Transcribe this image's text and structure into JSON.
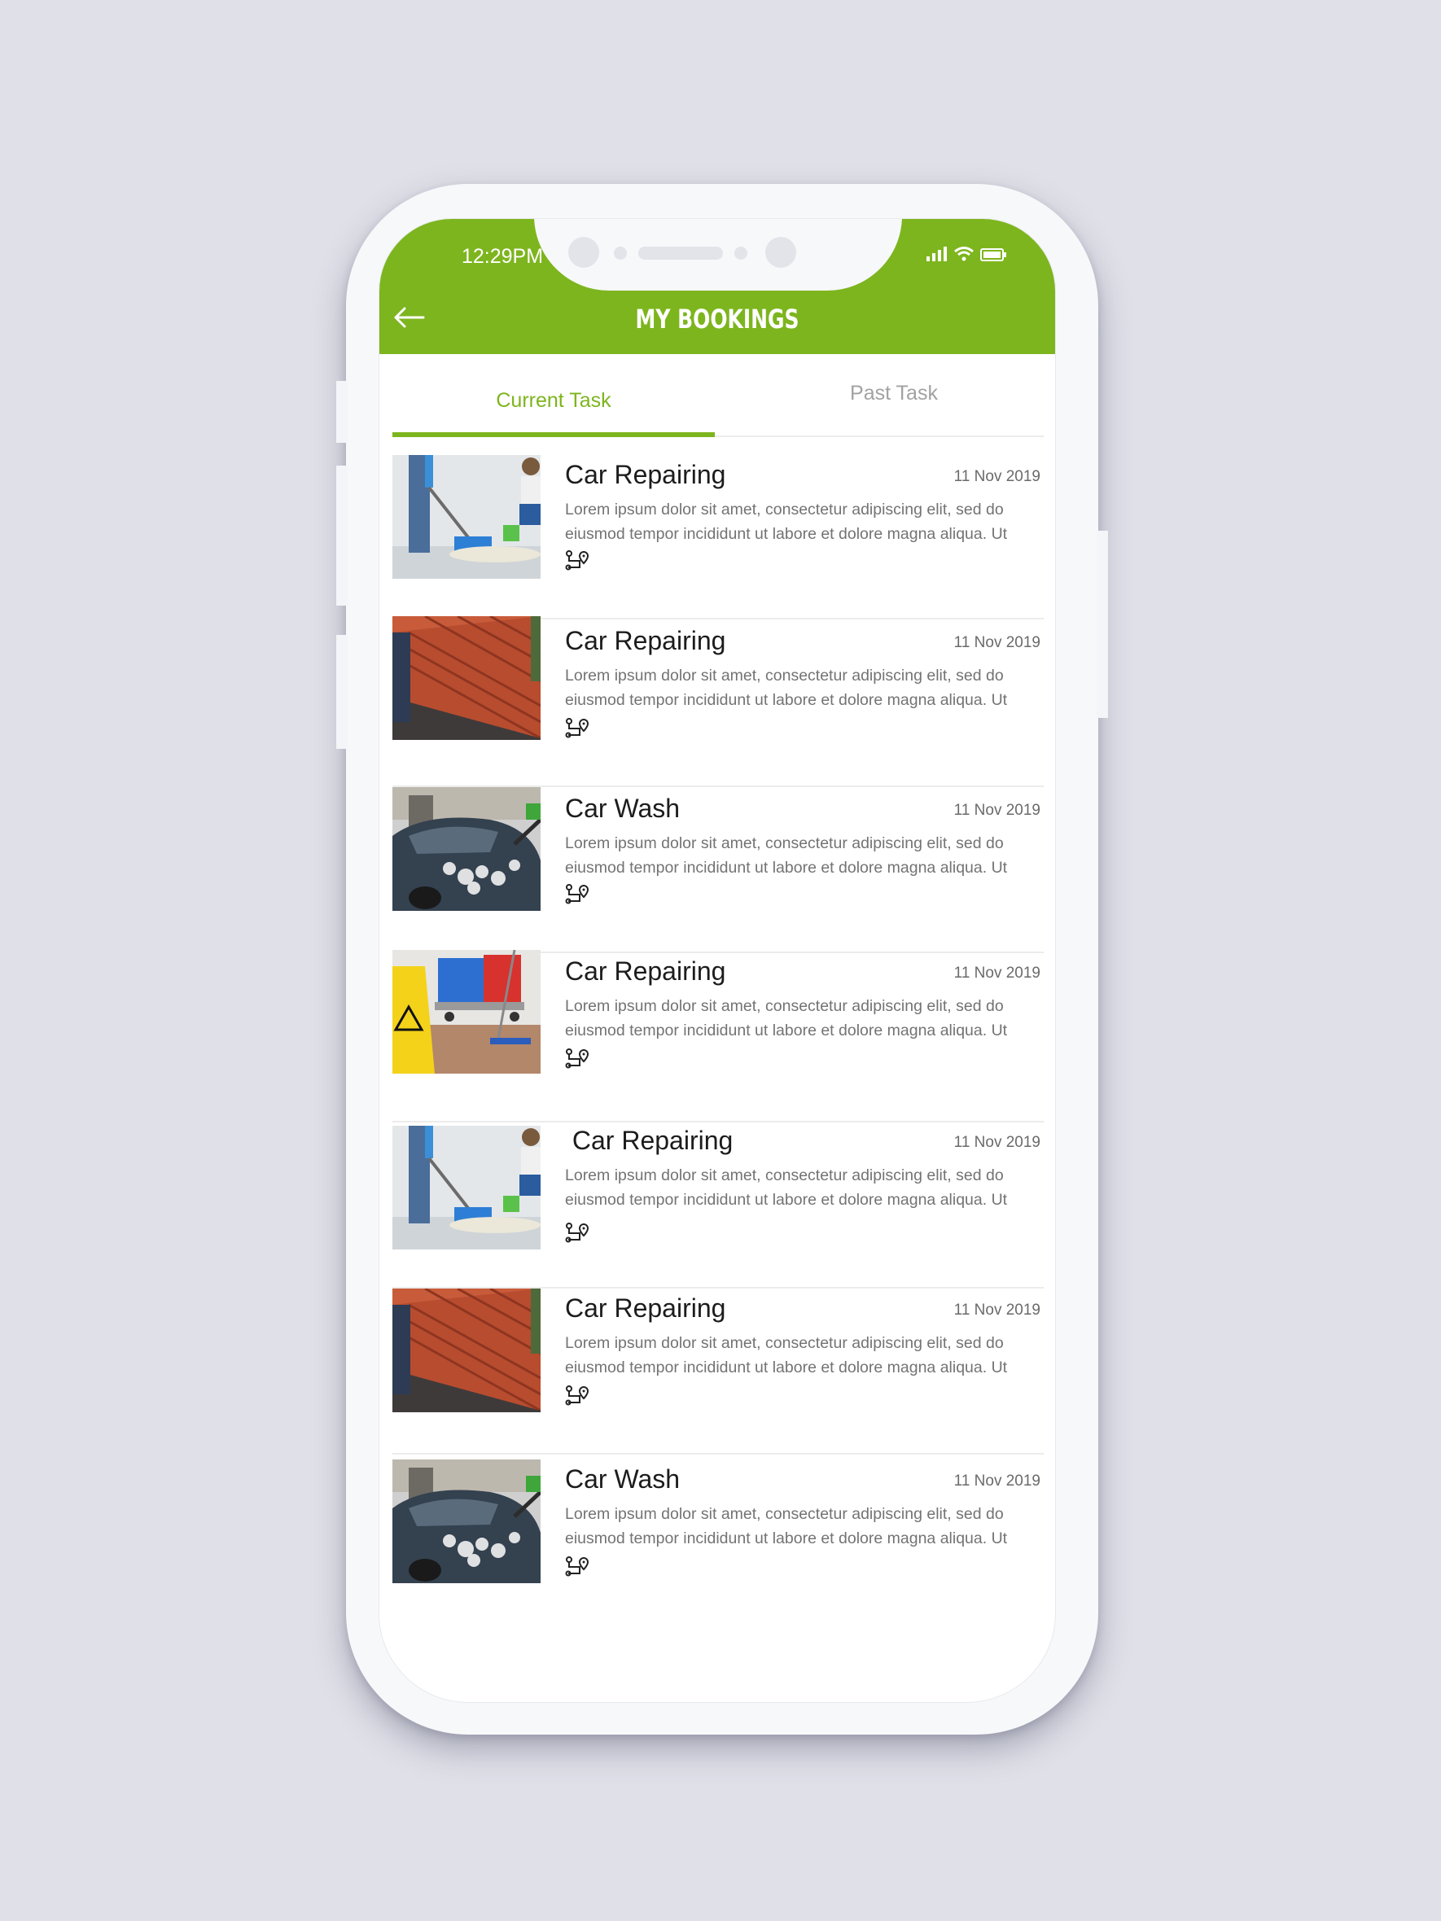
{
  "status_bar": {
    "time": "12:29PM"
  },
  "header": {
    "title": "MY BOOKINGS",
    "back_icon": "arrow-left-icon"
  },
  "tabs": [
    {
      "label": "Current Task",
      "active": true
    },
    {
      "label": "Past Task",
      "active": false
    }
  ],
  "colors": {
    "accent": "#7db51e",
    "background": "#dfe0e8"
  },
  "bookings": [
    {
      "title": "Car Repairing",
      "date": "11 Nov 2019",
      "desc_line1": "Lorem ipsum dolor sit amet, consectetur adipiscing elit, sed do",
      "desc_line2": "eiusmod tempor incididunt ut labore et dolore magna aliqua. Ut",
      "image": "mopping-floor-photo"
    },
    {
      "title": "Car Repairing",
      "date": "11 Nov 2019",
      "desc_line1": "Lorem ipsum dolor sit amet, consectetur adipiscing elit, sed do",
      "desc_line2": "eiusmod tempor incididunt ut labore et dolore magna aliqua. Ut",
      "image": "roof-washing-photo"
    },
    {
      "title": "Car Wash",
      "date": "11 Nov 2019",
      "desc_line1": "Lorem ipsum dolor sit amet, consectetur adipiscing elit, sed do",
      "desc_line2": "eiusmod tempor incididunt ut labore et dolore magna aliqua. Ut",
      "image": "car-foam-wash-photo"
    },
    {
      "title": "Car Repairing",
      "date": "11 Nov 2019",
      "desc_line1": "Lorem ipsum dolor sit amet, consectetur adipiscing elit, sed do",
      "desc_line2": "eiusmod tempor incididunt ut labore et dolore magna aliqua. Ut",
      "image": "caution-sign-cleaning-cart-photo"
    },
    {
      "title": " Car Repairing",
      "date": "11 Nov 2019",
      "desc_line1": "Lorem ipsum dolor sit amet, consectetur adipiscing elit, sed do",
      "desc_line2": "eiusmod tempor incididunt ut labore et dolore magna aliqua. Ut",
      "image": "mopping-floor-photo"
    },
    {
      "title": "Car Repairing",
      "date": "11 Nov 2019",
      "desc_line1": "Lorem ipsum dolor sit amet, consectetur adipiscing elit, sed do",
      "desc_line2": "eiusmod tempor incididunt ut labore et dolore magna aliqua. Ut",
      "image": "roof-washing-photo"
    },
    {
      "title": "Car Wash",
      "date": "11 Nov 2019",
      "desc_line1": "Lorem ipsum dolor sit amet, consectetur adipiscing elit, sed do",
      "desc_line2": "eiusmod tempor incididunt ut labore et dolore magna aliqua. Ut",
      "image": "car-foam-wash-photo"
    }
  ]
}
